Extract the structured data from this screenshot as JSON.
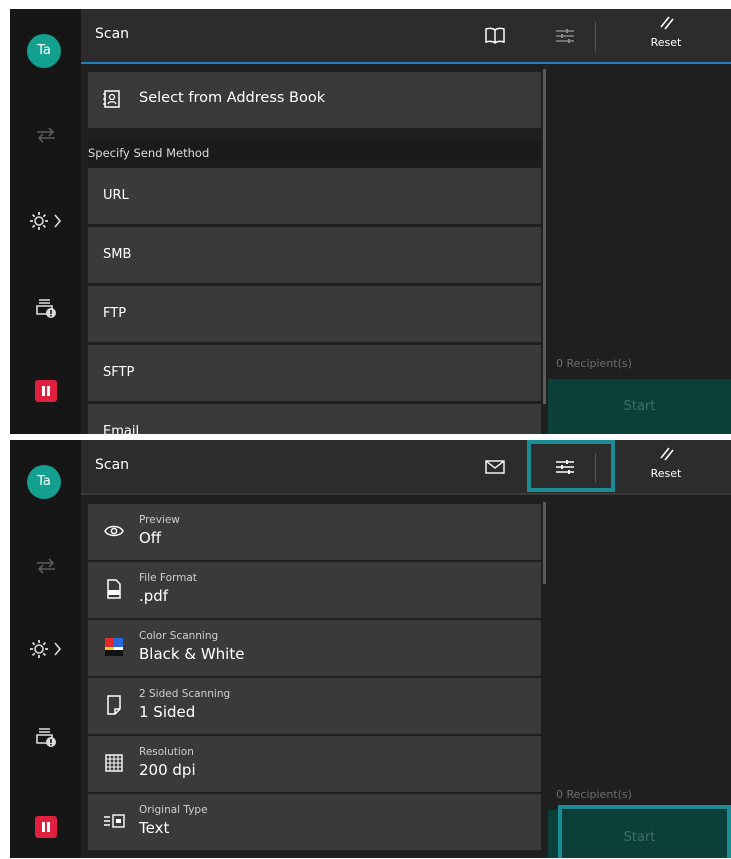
{
  "user_initials": "Ta",
  "colors": {
    "accent_teal": "#14a08f",
    "highlight": "#1a8c95",
    "pause_red": "#e0203f",
    "header_line": "#1e7fc2"
  },
  "top_screen": {
    "title": "Scan",
    "reset_label": "Reset",
    "address_book_label": "Select from Address Book",
    "section_label": "Specify Send Method",
    "send_methods": [
      "URL",
      "SMB",
      "FTP",
      "SFTP",
      "Email"
    ],
    "recipients": "0 Recipient(s)",
    "start_label": "Start"
  },
  "bottom_screen": {
    "title": "Scan",
    "reset_label": "Reset",
    "settings": [
      {
        "label": "Preview",
        "value": "Off",
        "icon": "eye-icon"
      },
      {
        "label": "File Format",
        "value": ".pdf",
        "icon": "file-format-icon"
      },
      {
        "label": "Color Scanning",
        "value": "Black & White",
        "icon": "color-scanning-icon"
      },
      {
        "label": "2 Sided Scanning",
        "value": "1 Sided",
        "icon": "page-icon"
      },
      {
        "label": "Resolution",
        "value": "200 dpi",
        "icon": "grid-icon"
      },
      {
        "label": "Original Type",
        "value": "Text",
        "icon": "original-type-icon"
      }
    ],
    "recipients": "0 Recipient(s)",
    "start_label": "Start"
  }
}
